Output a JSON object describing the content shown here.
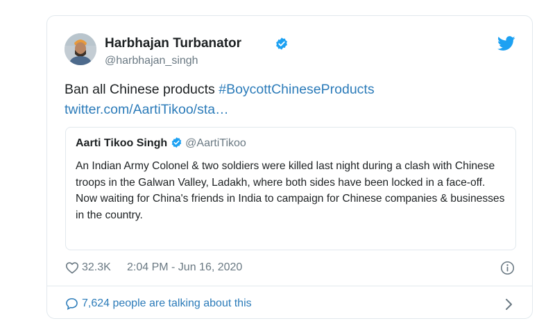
{
  "tweet": {
    "author_name": "Harbhajan Turbanator",
    "author_handle": "@harbhajan_singh",
    "text": "Ban all Chinese products ",
    "hashtag": "#BoycottChineseProducts",
    "link": "twitter.com/AartiTikoo/sta…",
    "likes": "32.3K",
    "timestamp": "2:04 PM - Jun 16, 2020",
    "conversation": "7,624 people are talking about this"
  },
  "quoted": {
    "author_name": "Aarti Tikoo Singh",
    "author_handle": "@AartiTikoo",
    "line1": "An Indian Army Colonel & two soldiers were killed last night during a clash with Chinese troops in the Galwan Valley, Ladakh, where both sides have been locked in a face-off.",
    "line2": "Now waiting for China's friends in India to campaign for Chinese companies & businesses in the country."
  },
  "icons": {
    "verified": "verified-badge-icon",
    "bird": "twitter-bird-icon",
    "like": "heart-icon",
    "info": "info-icon",
    "conversation": "speech-bubble-icon",
    "chevron": "chevron-right-icon"
  },
  "colors": {
    "link": "#2b7bb9",
    "verified": "#1da1f2",
    "muted": "#697882",
    "border": "#e1e8ed"
  }
}
